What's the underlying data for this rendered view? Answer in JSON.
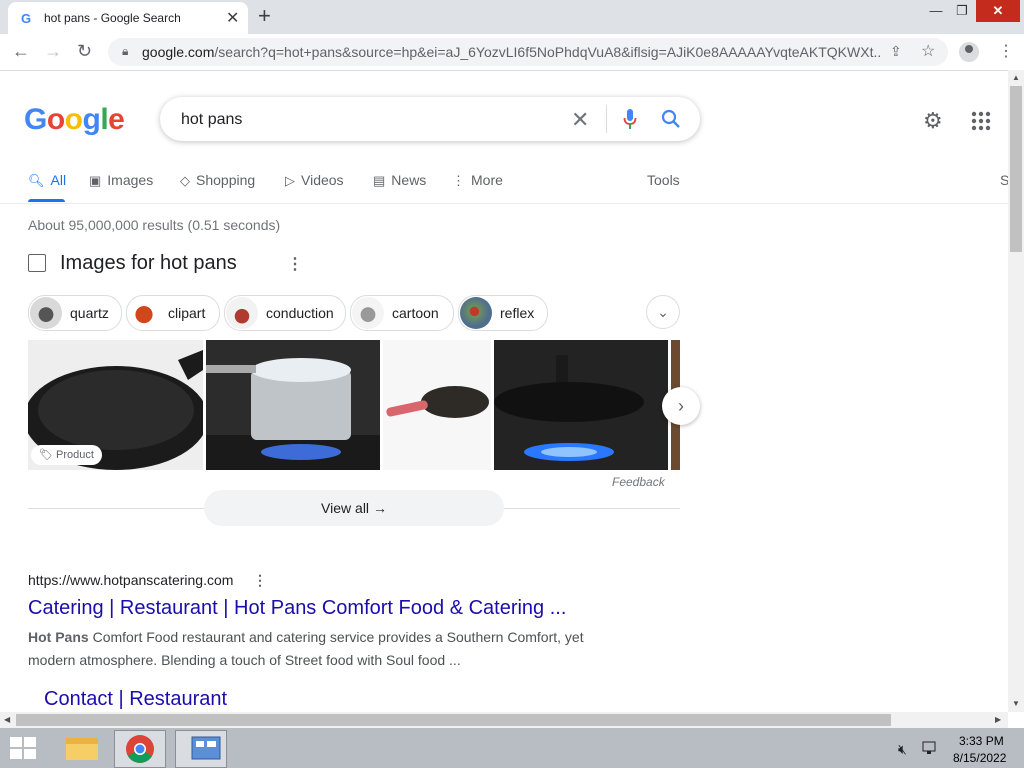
{
  "browser": {
    "tab_title": "hot pans - Google Search",
    "favicon": "G",
    "new_tab": "+",
    "url_main": "google.com",
    "url_rest": "/search?q=hot+pans&source=hp&ei=aJ_6YozvLI6f5NoPhdqVuA8&iflsig=AJiK0e8AAAAAYvqteAKTQKWXt..."
  },
  "search": {
    "query": "hot pans"
  },
  "nav": {
    "all": "All",
    "images": "Images",
    "shopping": "Shopping",
    "videos": "Videos",
    "news": "News",
    "more": "More",
    "tools": "Tools",
    "s": "S"
  },
  "stats": "About 95,000,000 results (0.51 seconds)",
  "images_section": {
    "heading": "Images for hot pans",
    "chips": [
      "quartz",
      "clipart",
      "conduction",
      "cartoon",
      "reflex"
    ],
    "product_badge": "Product",
    "feedback": "Feedback",
    "view_all": "View all"
  },
  "result": {
    "url": "https://www.hotpanscatering.com",
    "title": "Catering | Restaurant | Hot Pans Comfort Food & Catering ...",
    "snippet_bold": "Hot Pans",
    "snippet": " Comfort Food restaurant and catering service provides a Southern Comfort, yet modern atmosphere. Blending a touch of Street food with Soul food ...",
    "sublink": "Contact | Restaurant"
  },
  "taskbar": {
    "time": "3:33 PM",
    "date": "8/15/2022"
  },
  "colors": {
    "link": "#1a0dab",
    "accent": "#1a73e8",
    "close": "#c42b1c"
  }
}
